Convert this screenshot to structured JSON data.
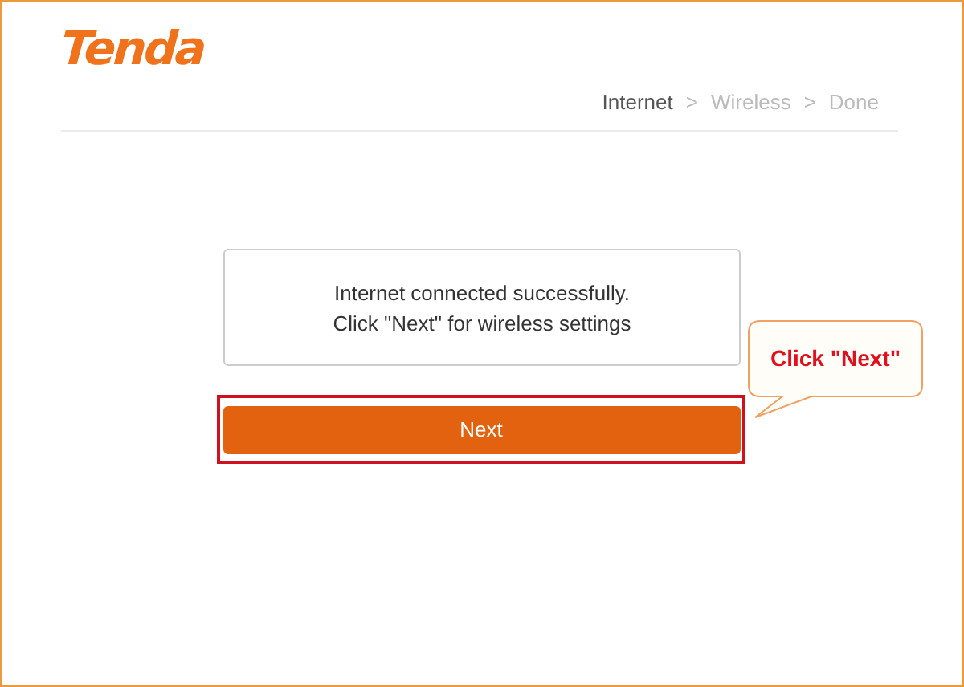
{
  "logo": "Tenda",
  "steps": [
    {
      "label": "Internet",
      "selected": true,
      "separator": ">"
    },
    {
      "label": "Wireless",
      "selected": false,
      "separator": ">"
    },
    {
      "label": "Done",
      "selected": false
    }
  ],
  "message": [
    "Internet connected successfully.",
    "Click \"Next\" for wireless settings"
  ],
  "next_button": {
    "label": "Next",
    "highlighted": true
  },
  "callout": "Click \"Next\""
}
